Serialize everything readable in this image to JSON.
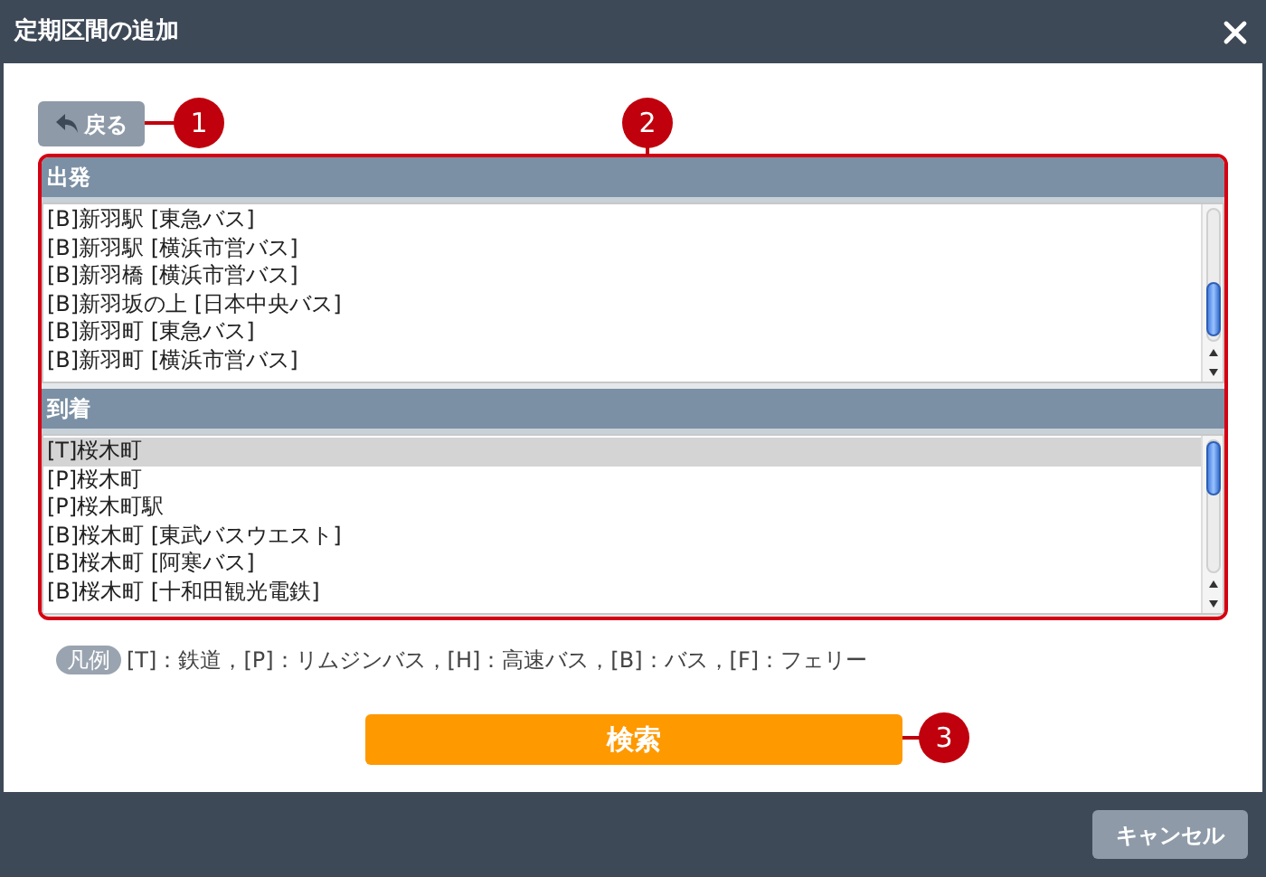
{
  "window": {
    "title": "定期区間の追加"
  },
  "back_button": {
    "label": "戻る"
  },
  "lists": [
    {
      "header": "出発",
      "items": [
        {
          "label": "[B]新羽駅 [東急バス]",
          "selected": false
        },
        {
          "label": "[B]新羽駅 [横浜市営バス]",
          "selected": false
        },
        {
          "label": "[B]新羽橋 [横浜市営バス]",
          "selected": false
        },
        {
          "label": "[B]新羽坂の上 [日本中央バス]",
          "selected": false
        },
        {
          "label": "[B]新羽町 [東急バス]",
          "selected": false
        },
        {
          "label": "[B]新羽町 [横浜市営バス]",
          "selected": false
        }
      ]
    },
    {
      "header": "到着",
      "items": [
        {
          "label": "[T]桜木町",
          "selected": true
        },
        {
          "label": "[P]桜木町",
          "selected": false
        },
        {
          "label": "[P]桜木町駅",
          "selected": false
        },
        {
          "label": "[B]桜木町 [東武バスウエスト]",
          "selected": false
        },
        {
          "label": "[B]桜木町 [阿寒バス]",
          "selected": false
        },
        {
          "label": "[B]桜木町 [十和田観光電鉄]",
          "selected": false
        }
      ]
    }
  ],
  "legend": {
    "badge": "凡例",
    "text": "[T]：鉄道，[P]：リムジンバス，[H]：高速バス，[B]：バス，[F]：フェリー"
  },
  "search_button": {
    "label": "検索"
  },
  "annotations": [
    "1",
    "2",
    "3"
  ],
  "footer": {
    "cancel_button": "キャンセル"
  }
}
